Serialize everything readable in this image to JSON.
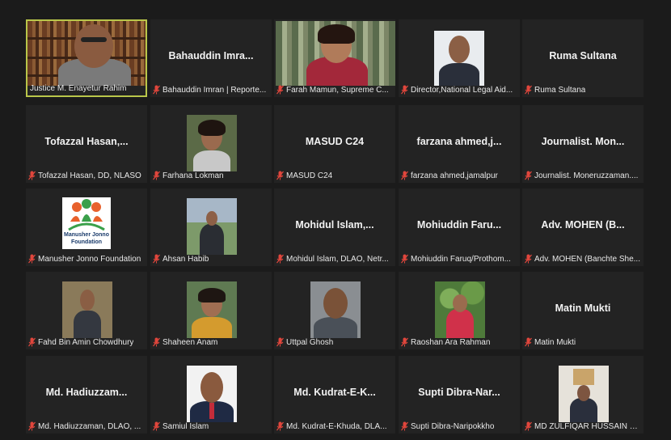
{
  "participants": [
    {
      "display_name": "",
      "label": "Justice M. Enayetur Rahim",
      "video": "justice-video",
      "active": true
    },
    {
      "display_name": "Bahauddin Imra...",
      "label": "Bahauddin Imran | Reporte...",
      "video": null
    },
    {
      "display_name": "",
      "label": "Farah Mamun, Supreme C...",
      "video": "farah-video"
    },
    {
      "display_name": "",
      "label": "Director,National Legal Aid...",
      "video": "director-video"
    },
    {
      "display_name": "Ruma Sultana",
      "label": "Ruma Sultana",
      "video": null
    },
    {
      "display_name": "Tofazzal Hasan,...",
      "label": "Tofazzal Hasan, DD, NLASO",
      "video": null
    },
    {
      "display_name": "",
      "label": "Farhana Lokman",
      "video": "farhana-video"
    },
    {
      "display_name": "MASUD C24",
      "label": "MASUD C24",
      "video": null
    },
    {
      "display_name": "farzana ahmed,j...",
      "label": "farzana ahmed,jamalpur",
      "video": null
    },
    {
      "display_name": "Journalist. Mon...",
      "label": "Journalist. Moneruzzaman....",
      "video": null
    },
    {
      "display_name": "",
      "label": "Manusher Jonno Foundation",
      "video": "mjf-logo"
    },
    {
      "display_name": "",
      "label": "Ahsan Habib",
      "video": "ahsan-video"
    },
    {
      "display_name": "Mohidul Islam,...",
      "label": "Mohidul Islam, DLAO, Netr...",
      "video": null
    },
    {
      "display_name": "Mohiuddin Faru...",
      "label": "Mohiuddin Faruq/Prothom...",
      "video": null
    },
    {
      "display_name": "Adv. MOHEN (B...",
      "label": "Adv. MOHEN (Banchte She...",
      "video": null
    },
    {
      "display_name": "",
      "label": "Fahd Bin Amin Chowdhury",
      "video": "fahd-video"
    },
    {
      "display_name": "",
      "label": "Shaheen Anam",
      "video": "shaheen-video"
    },
    {
      "display_name": "",
      "label": "Uttpal Ghosh",
      "video": "uttpal-video"
    },
    {
      "display_name": "",
      "label": "Raoshan Ara Rahman",
      "video": "raoshan-video"
    },
    {
      "display_name": "Matin Mukti",
      "label": "Matin Mukti",
      "video": null
    },
    {
      "display_name": "Md. Hadiuzzam...",
      "label": "Md. Hadiuzzaman, DLAO, ...",
      "video": null
    },
    {
      "display_name": "",
      "label": "Samiul Islam",
      "video": "samiul-video"
    },
    {
      "display_name": "Md. Kudrat-E-K...",
      "label": "Md. Kudrat-E-Khuda, DLA...",
      "video": null
    },
    {
      "display_name": "Supti Dibra-Nar...",
      "label": "Supti Dibra-Naripokkho",
      "video": null
    },
    {
      "display_name": "",
      "label": "MD ZULFIQAR HUSSAIN R...",
      "video": "zulfiqar-video"
    }
  ],
  "logo": {
    "line1": "Manusher Jonno",
    "line2": "Foundation"
  },
  "colors": {
    "active_border": "#b9c64a",
    "muted_mic": "#e0463c",
    "tile_bg": "#232323"
  }
}
